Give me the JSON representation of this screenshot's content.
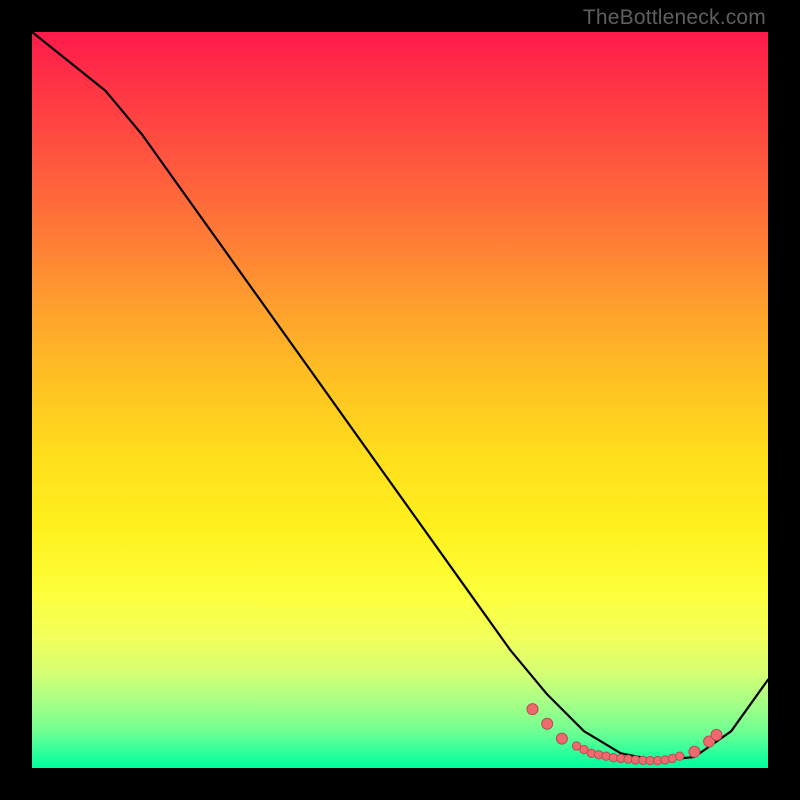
{
  "watermark": "TheBottleneck.com",
  "colors": {
    "curve": "#000000",
    "point_fill": "#ef6a6f",
    "point_stroke": "#b94c53"
  },
  "chart_data": {
    "type": "line",
    "title": "",
    "xlabel": "",
    "ylabel": "",
    "xlim": [
      0,
      100
    ],
    "ylim": [
      0,
      100
    ],
    "x": [
      0,
      5,
      10,
      15,
      20,
      25,
      30,
      35,
      40,
      45,
      50,
      55,
      60,
      65,
      70,
      75,
      80,
      85,
      90,
      95,
      100
    ],
    "values": [
      100,
      96,
      92,
      86,
      79,
      72,
      65,
      58,
      51,
      44,
      37,
      30,
      23,
      16,
      10,
      5,
      2,
      1,
      1.5,
      5,
      12
    ],
    "highlight_points": {
      "x": [
        68,
        70,
        72,
        74,
        75,
        76,
        77,
        78,
        79,
        80,
        81,
        82,
        83,
        84,
        85,
        86,
        87,
        88,
        90,
        92,
        93
      ],
      "y": [
        8,
        6,
        4,
        3,
        2.5,
        2,
        1.8,
        1.6,
        1.4,
        1.3,
        1.2,
        1.1,
        1.05,
        1,
        1,
        1.1,
        1.3,
        1.6,
        2.2,
        3.6,
        4.5
      ]
    }
  }
}
